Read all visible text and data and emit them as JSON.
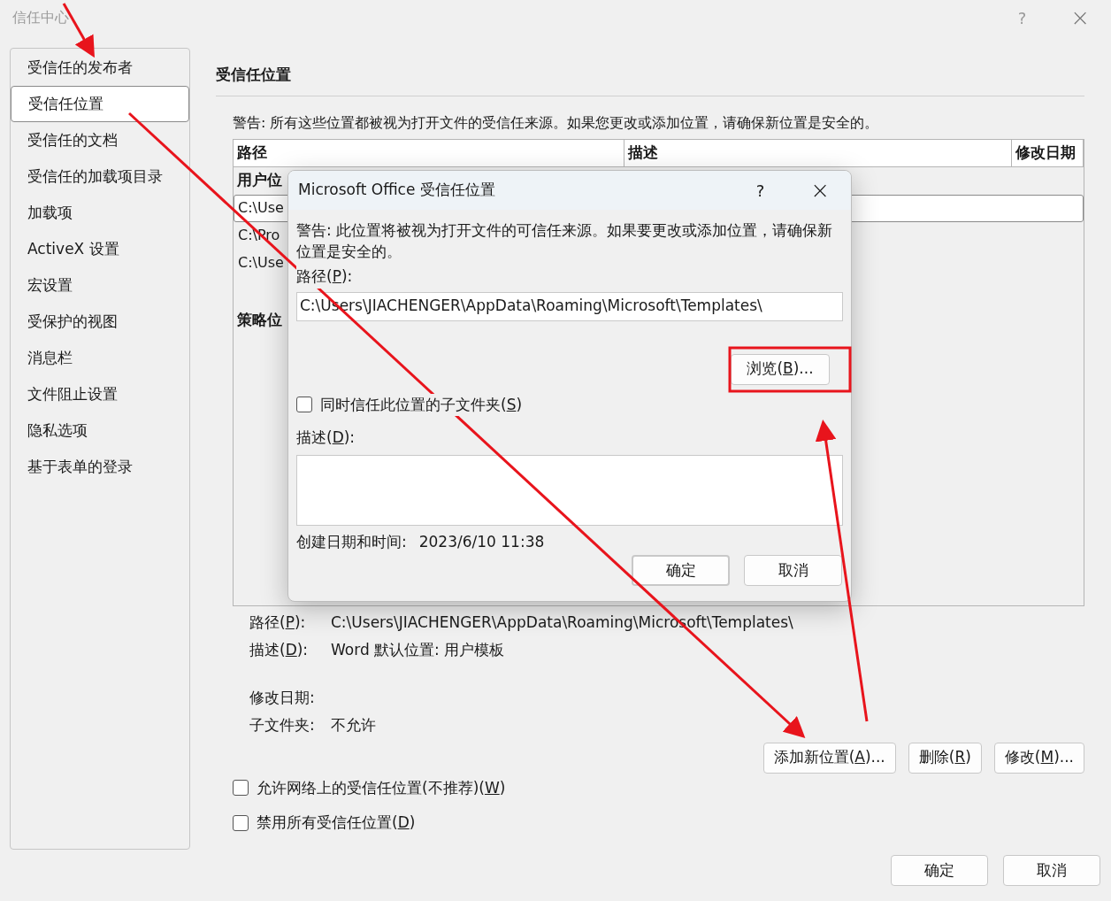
{
  "window": {
    "title": "信任中心",
    "help": "?",
    "close": "×"
  },
  "sidebar": {
    "items": [
      {
        "label": "受信任的发布者",
        "selected": false
      },
      {
        "label": "受信任位置",
        "selected": true
      },
      {
        "label": "受信任的文档",
        "selected": false
      },
      {
        "label": "受信任的加载项目录",
        "selected": false
      },
      {
        "label": "加载项",
        "selected": false
      },
      {
        "label": "ActiveX 设置",
        "selected": false
      },
      {
        "label": "宏设置",
        "selected": false
      },
      {
        "label": "受保护的视图",
        "selected": false
      },
      {
        "label": "消息栏",
        "selected": false
      },
      {
        "label": "文件阻止设置",
        "selected": false
      },
      {
        "label": "隐私选项",
        "selected": false
      },
      {
        "label": "基于表单的登录",
        "selected": false
      }
    ]
  },
  "section_title": "受信任位置",
  "warning": "警告: 所有这些位置都被视为打开文件的受信任来源。如果您更改或添加位置，请确保新位置是安全的。",
  "table": {
    "columns": [
      "路径",
      "描述",
      "修改日期"
    ],
    "groups": [
      {
        "label": "用户位",
        "rows": [
          {
            "path": "C:\\Use",
            "selected": true
          },
          {
            "path": "C:\\Pro",
            "selected": false
          },
          {
            "path": "C:\\Use",
            "selected": false
          }
        ]
      },
      {
        "label": "策略位"
      }
    ]
  },
  "details": [
    {
      "label": {
        "before": "路径(",
        "key": "P",
        "after": "):"
      },
      "value": "C:\\Users\\JIACHENGER\\AppData\\Roaming\\Microsoft\\Templates\\"
    },
    {
      "label": {
        "before": "描述(",
        "key": "D",
        "after": "):"
      },
      "value": "Word 默认位置: 用户模板"
    },
    {
      "label": {
        "before": "修改日期:"
      }
    },
    {
      "label": {
        "before": "子文件夹:"
      },
      "value": "不允许"
    }
  ],
  "actions": [
    {
      "before": "添加新位置(",
      "key": "A",
      "after": ")..."
    },
    {
      "before": "删除(",
      "key": "R",
      "after": ")"
    },
    {
      "before": "修改(",
      "key": "M",
      "after": ")..."
    }
  ],
  "options": [
    {
      "label": {
        "before": "允许网络上的受信任位置(不推荐)(",
        "key": "W",
        "after": ")"
      },
      "checked": false
    },
    {
      "label": {
        "before": "禁用所有受信任位置(",
        "key": "D",
        "after": ")"
      },
      "checked": false
    }
  ],
  "footer": [
    "确定",
    "取消"
  ],
  "dialog": {
    "title": "Microsoft Office 受信任位置",
    "help": "?",
    "close": "×",
    "warning": "警告: 此位置将被视为打开文件的可信任来源。如果要更改或添加位置，请确保新位置是安全的。",
    "path_label": {
      "before": "路径(",
      "key": "P",
      "after": "):"
    },
    "path": "C:\\Users\\JIACHENGER\\AppData\\Roaming\\Microsoft\\Templates\\",
    "browse": {
      "before": "浏览(",
      "key": "B",
      "after": ")..."
    },
    "subfolders": {
      "label": {
        "before": "同时信任此位置的子文件夹(",
        "key": "S",
        "after": ")"
      },
      "checked": false
    },
    "description_label": {
      "before": "描述(",
      "key": "D",
      "after": "):"
    },
    "created_label": "创建日期和时间:",
    "created": "2023/6/10 11:38",
    "buttons": [
      {
        "label": "确定",
        "default": true
      },
      {
        "label": "取消",
        "default": false
      }
    ]
  }
}
